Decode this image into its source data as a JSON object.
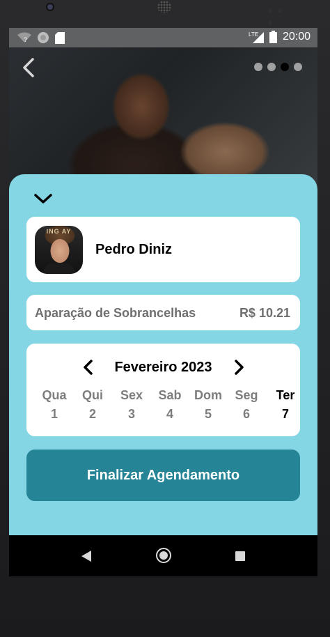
{
  "status_bar": {
    "time": "20:00",
    "network": "LTE",
    "icons": [
      "wifi-icon",
      "sync-icon",
      "sd-card-icon",
      "signal-icon",
      "battery-icon"
    ]
  },
  "hero": {
    "carousel_total": 4,
    "carousel_active_index": 2
  },
  "barber": {
    "name": "Pedro Diniz",
    "avatar_banner": "ING AY"
  },
  "service": {
    "name": "Aparação de Sobrancelhas",
    "price": "R$ 10.21"
  },
  "calendar": {
    "month_label": "Fevereiro 2023",
    "days": [
      {
        "name": "Qua",
        "date": "1",
        "selected": false
      },
      {
        "name": "Qui",
        "date": "2",
        "selected": false
      },
      {
        "name": "Sex",
        "date": "3",
        "selected": false
      },
      {
        "name": "Sab",
        "date": "4",
        "selected": false
      },
      {
        "name": "Dom",
        "date": "5",
        "selected": false
      },
      {
        "name": "Seg",
        "date": "6",
        "selected": false
      },
      {
        "name": "Ter",
        "date": "7",
        "selected": true
      }
    ]
  },
  "actions": {
    "finalize_label": "Finalizar Agendamento"
  },
  "colors": {
    "sheet_background": "#84d6e4",
    "primary_button": "#258496",
    "muted_text": "#6f6f6f"
  }
}
